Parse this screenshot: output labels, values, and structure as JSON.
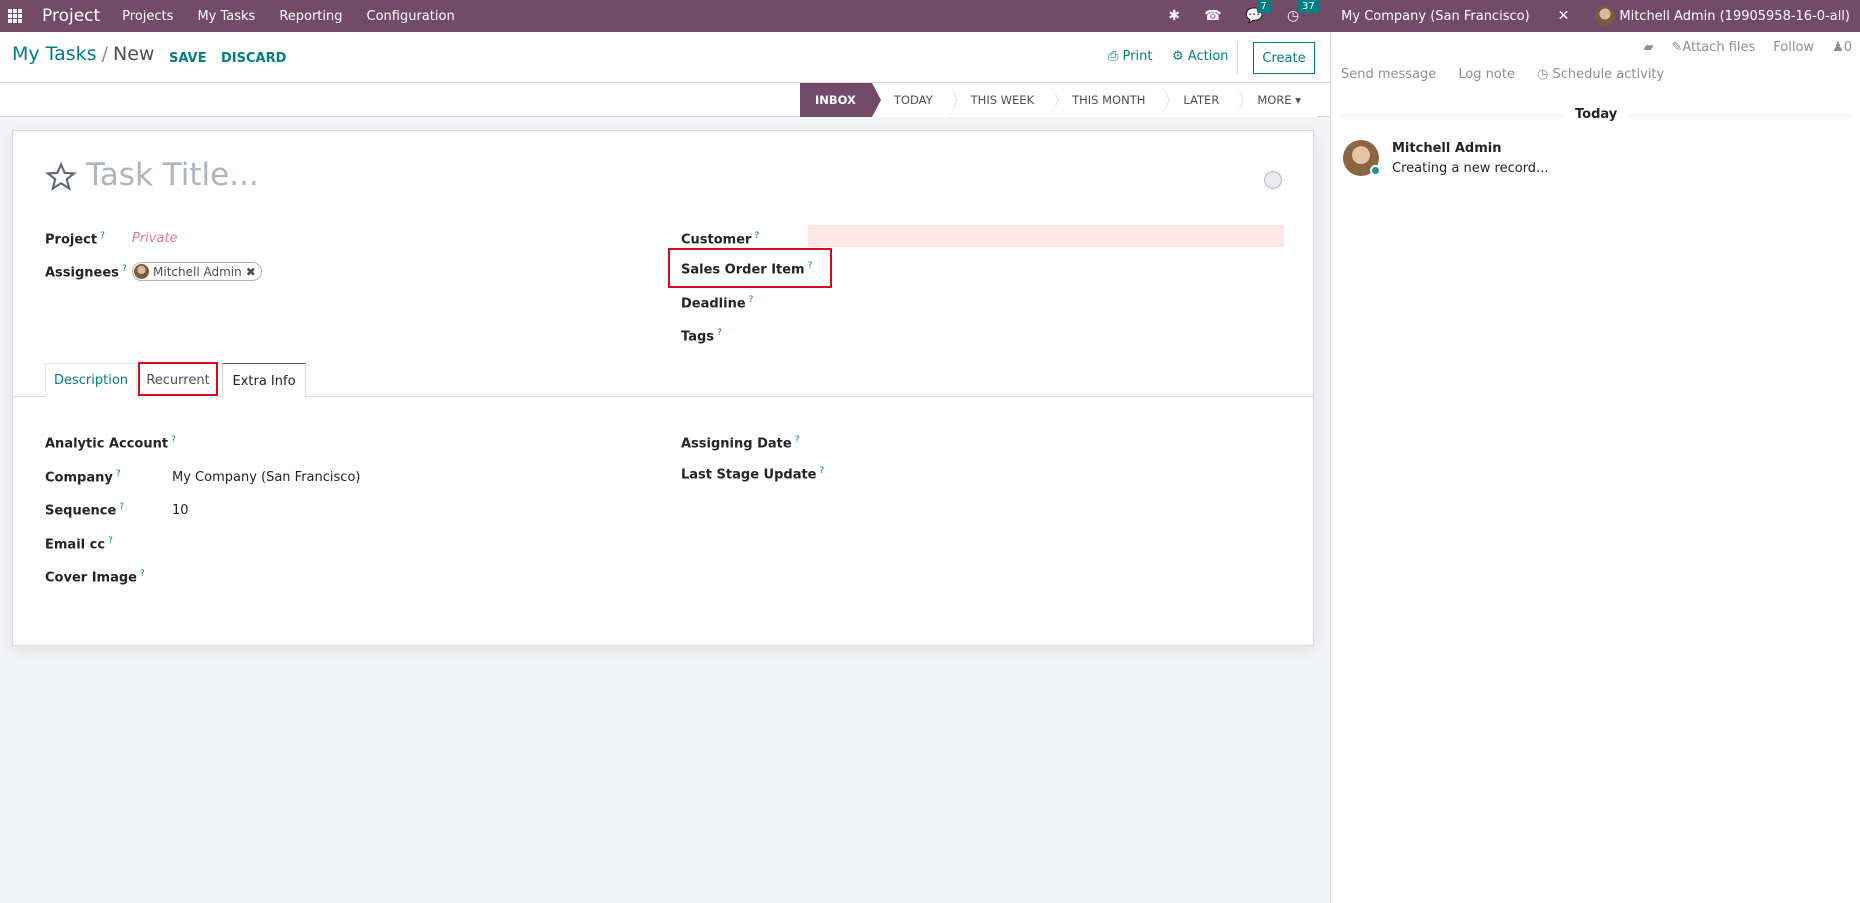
{
  "navbar": {
    "app_name": "Project",
    "menu": [
      "Projects",
      "My Tasks",
      "Reporting",
      "Configuration"
    ],
    "messages_count": "7",
    "activities_count": "37",
    "company": "My Company (San Francisco)",
    "user": "Mitchell Admin (19905958-16-0-all)"
  },
  "control_panel": {
    "breadcrumb_parent": "My Tasks",
    "breadcrumb_sep": "/",
    "breadcrumb_current": "New",
    "save": "SAVE",
    "discard": "DISCARD",
    "print": "Print",
    "action": "Action",
    "create": "Create"
  },
  "stages": [
    "INBOX",
    "TODAY",
    "THIS WEEK",
    "THIS MONTH",
    "LATER",
    "MORE ▾"
  ],
  "form": {
    "title_placeholder": "Task Title...",
    "project_label": "Project",
    "project_value": "Private",
    "assignees_label": "Assignees",
    "assignee": "Mitchell Admin",
    "customer_label": "Customer",
    "sales_order_item_label": "Sales Order Item",
    "deadline_label": "Deadline",
    "tags_label": "Tags",
    "help_mark": "?"
  },
  "tabs": [
    "Description",
    "Recurrent",
    "Extra Info"
  ],
  "extra_info": {
    "analytic_account_label": "Analytic Account",
    "company_label": "Company",
    "company_value": "My Company (San Francisco)",
    "sequence_label": "Sequence",
    "sequence_value": "10",
    "email_cc_label": "Email cc",
    "cover_image_label": "Cover Image",
    "assigning_date_label": "Assigning Date",
    "last_stage_update_label": "Last Stage Update"
  },
  "chatter": {
    "attach_files": "Attach files",
    "follow": "Follow",
    "followers_count": "0",
    "send_message": "Send message",
    "log_note": "Log note",
    "schedule_activity": "Schedule activity",
    "day_separator": "Today",
    "message_author": "Mitchell Admin",
    "message_body": "Creating a new record..."
  },
  "colors": {
    "brand": "#714b67",
    "accent": "#017e84",
    "highlight": "#d40b1c"
  }
}
